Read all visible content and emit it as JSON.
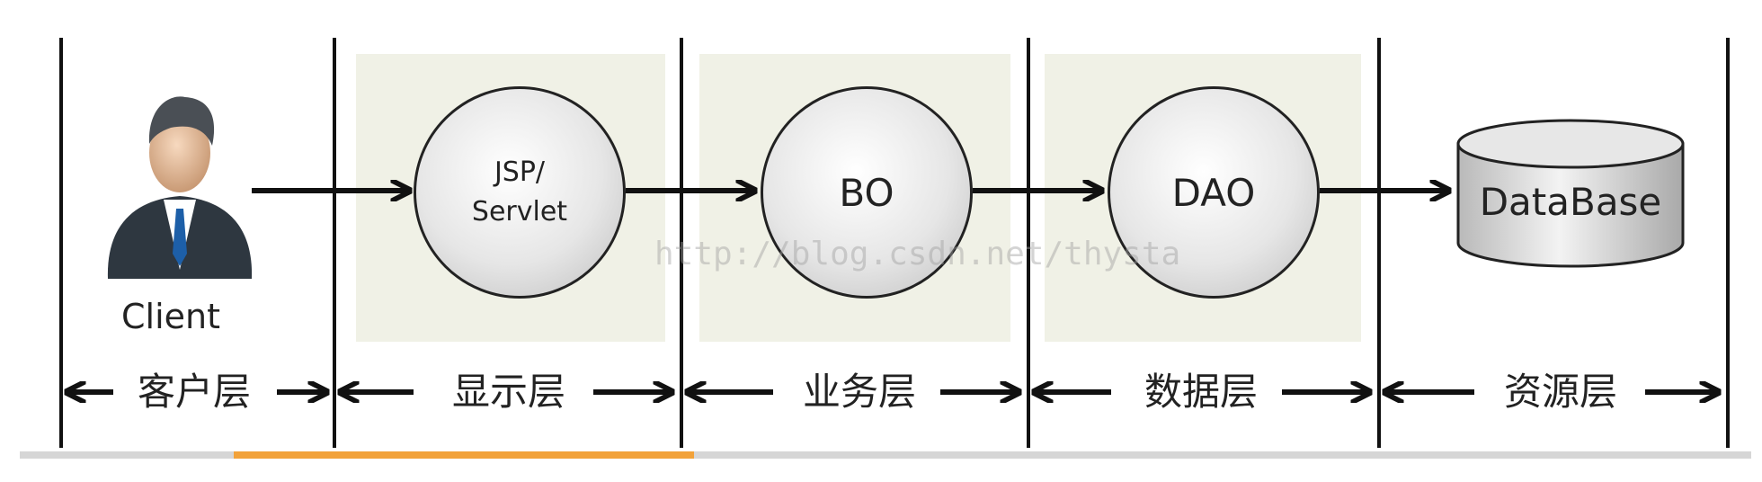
{
  "diagram": {
    "client_label": "Client",
    "nodes": [
      {
        "id": "jsp",
        "label": "JSP/\nServlet"
      },
      {
        "id": "bo",
        "label": "BO"
      },
      {
        "id": "dao",
        "label": "DAO"
      },
      {
        "id": "db",
        "label": "DataBase"
      }
    ],
    "tiers": [
      "客户层",
      "显示层",
      "业务层",
      "数据层",
      "资源层"
    ],
    "watermark": "http://blog.csdn.net/thysta",
    "colors": {
      "tier_background": "#f0f1e6",
      "lines": "#111111",
      "accent_bar": "#f2a23a",
      "bottom_bar": "#d6d6d6"
    }
  }
}
